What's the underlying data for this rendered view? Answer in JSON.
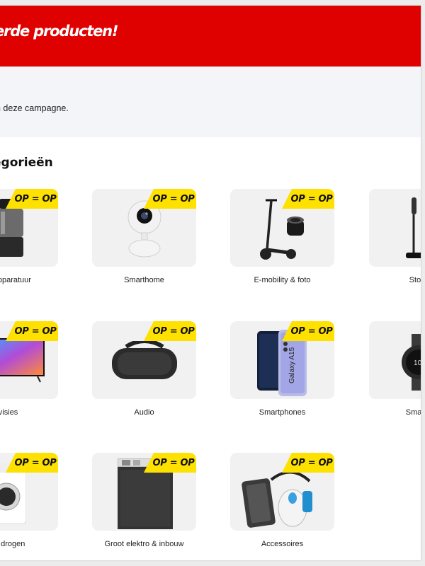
{
  "banner": {
    "title": "erde producten!"
  },
  "info": {
    "text": "n deze campagne."
  },
  "categories_heading": "egorieën",
  "badge_text": "OP = OP",
  "colors": {
    "brand_red": "#df0000",
    "badge_yellow": "#ffe100",
    "card_bg": "#f1f1f1"
  },
  "tiles": [
    {
      "label": "kenapparatuur",
      "icon": "coffee-machine-icon"
    },
    {
      "label": "Smarthome",
      "icon": "security-camera-icon"
    },
    {
      "label": "E-mobility & foto",
      "icon": "e-scooter-icon"
    },
    {
      "label": "Stofzui",
      "icon": "stick-vacuum-icon"
    },
    {
      "label": "evisies",
      "icon": "television-icon"
    },
    {
      "label": "Audio",
      "icon": "speaker-icon"
    },
    {
      "label": "Smartphones",
      "icon": "smartphone-icon"
    },
    {
      "label": "Smartwa",
      "icon": "smartwatch-icon"
    },
    {
      "label": "n & drogen",
      "icon": "washing-machine-icon"
    },
    {
      "label": "Groot elektro & inbouw",
      "icon": "dishwasher-icon"
    },
    {
      "label": "Accessoires",
      "icon": "accessories-icon"
    }
  ],
  "phone_brand_text": "Galaxy A15"
}
